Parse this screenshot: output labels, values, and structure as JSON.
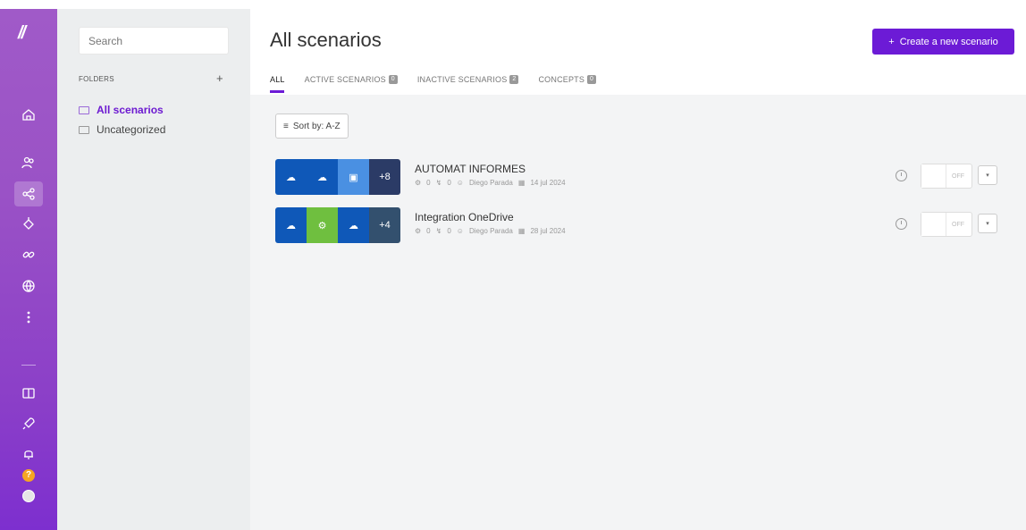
{
  "folders": {
    "search_placeholder": "Search",
    "header": "FOLDERS",
    "add": "+",
    "items": [
      {
        "label": "All scenarios"
      },
      {
        "label": "Uncategorized"
      }
    ]
  },
  "main": {
    "title": "All scenarios",
    "create_button": "Create a new scenario",
    "create_icon": "+",
    "tabs": [
      {
        "label": "ALL",
        "count": ""
      },
      {
        "label": "ACTIVE SCENARIOS",
        "count": "0"
      },
      {
        "label": "INACTIVE SCENARIOS",
        "count": "2"
      },
      {
        "label": "CONCEPTS",
        "count": "0"
      }
    ],
    "sort_label": "Sort by: A-Z",
    "scenarios": [
      {
        "name": "AUTOMAT INFORMES",
        "ops": "0",
        "transfer": "0",
        "owner": "Diego Parada",
        "date": "14 jul 2024",
        "more": "+8",
        "state": "OFF"
      },
      {
        "name": "Integration OneDrive",
        "ops": "0",
        "transfer": "0",
        "owner": "Diego Parada",
        "date": "28 jul 2024",
        "more": "+4",
        "state": "OFF"
      }
    ]
  },
  "colors": {
    "accent": "#6c1bd6",
    "onedrive": "#0f58b8",
    "rail_top": "#a05ac8",
    "rail_bottom": "#7d2fcf"
  }
}
